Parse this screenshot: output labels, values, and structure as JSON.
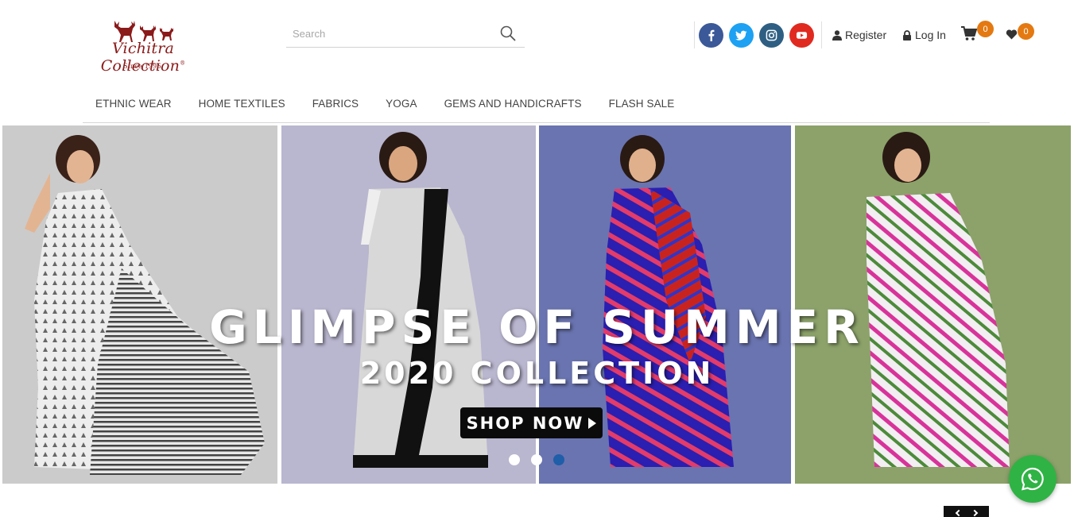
{
  "logo": {
    "brand": "Vichitra Collection",
    "reg_mark": "®",
    "since": "Since 1996"
  },
  "search": {
    "placeholder": "Search"
  },
  "social": [
    {
      "icon": "facebook-icon",
      "color": "#3b5998"
    },
    {
      "icon": "twitter-icon",
      "color": "#1da1f2"
    },
    {
      "icon": "instagram-icon",
      "color": "#2e5f83"
    },
    {
      "icon": "youtube-icon",
      "color": "#e02a20"
    }
  ],
  "account": {
    "register_label": "Register",
    "login_label": "Log In",
    "cart_count": "0",
    "wishlist_count": "0"
  },
  "nav": {
    "items": [
      "ETHNIC WEAR",
      "HOME TEXTILES",
      "FABRICS",
      "YOGA",
      "GEMS AND HANDICRAFTS",
      "FLASH SALE"
    ]
  },
  "banner": {
    "headline": "GLIMPSE OF SUMMER",
    "subheadline": "2020 COLLECTION",
    "cta_label": "SHOP NOW",
    "slide_count": 3,
    "active_slide": 3,
    "panel_colors": [
      "#cbcbcb",
      "#b9b6cf",
      "#6a74b0",
      "#8ca26a"
    ]
  },
  "colors": {
    "accent": "#e47911",
    "brand": "#8b1a1a",
    "whatsapp": "#2fb344",
    "active_dot": "#1f5ea8"
  }
}
